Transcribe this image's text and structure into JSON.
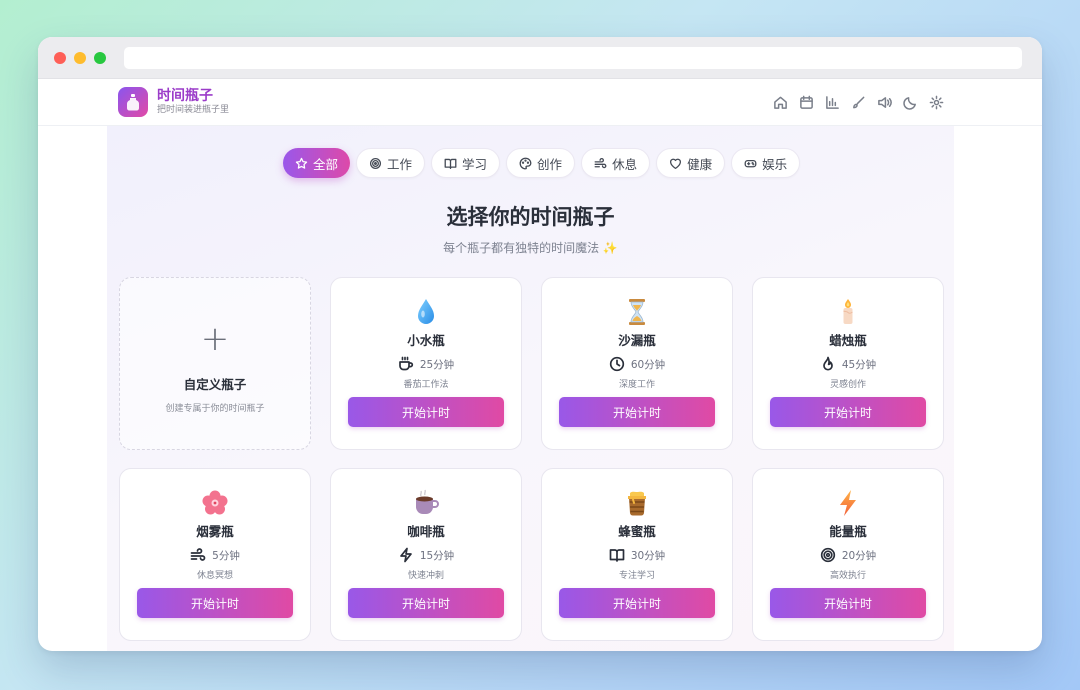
{
  "app": {
    "title": "时间瓶子",
    "subtitle": "把时间装进瓶子里"
  },
  "header_icons": [
    "home-icon",
    "calendar-icon",
    "chart-icon",
    "brush-icon",
    "volume-icon",
    "moon-icon",
    "gear-icon"
  ],
  "tabs": [
    {
      "label": "全部",
      "icon": "star-icon",
      "active": true
    },
    {
      "label": "工作",
      "icon": "target-icon",
      "active": false
    },
    {
      "label": "学习",
      "icon": "book-icon",
      "active": false
    },
    {
      "label": "创作",
      "icon": "palette-icon",
      "active": false
    },
    {
      "label": "休息",
      "icon": "wind-icon",
      "active": false
    },
    {
      "label": "健康",
      "icon": "heart-icon",
      "active": false
    },
    {
      "label": "娱乐",
      "icon": "gamepad-icon",
      "active": false
    }
  ],
  "main": {
    "title": "选择你的时间瓶子",
    "subtitle": "每个瓶子都有独特的时间魔法 ✨"
  },
  "custom_card": {
    "plus": "+",
    "title": "自定义瓶子",
    "subtitle": "创建专属于你的时间瓶子"
  },
  "bottles": [
    {
      "name": "小水瓶",
      "duration": "25分钟",
      "desc": "番茄工作法",
      "emoji": "droplet-emoji",
      "dur_icon": "coffee-icon",
      "button": "开始计时"
    },
    {
      "name": "沙漏瓶",
      "duration": "60分钟",
      "desc": "深度工作",
      "emoji": "hourglass-emoji",
      "dur_icon": "clock-icon",
      "button": "开始计时"
    },
    {
      "name": "蜡烛瓶",
      "duration": "45分钟",
      "desc": "灵感创作",
      "emoji": "candle-emoji",
      "dur_icon": "flame-icon",
      "button": "开始计时"
    },
    {
      "name": "烟雾瓶",
      "duration": "5分钟",
      "desc": "休息冥想",
      "emoji": "blossom-emoji",
      "dur_icon": "wind-icon",
      "button": "开始计时"
    },
    {
      "name": "咖啡瓶",
      "duration": "15分钟",
      "desc": "快速冲刺",
      "emoji": "coffee-cup-emoji",
      "dur_icon": "bolt-icon",
      "button": "开始计时"
    },
    {
      "name": "蜂蜜瓶",
      "duration": "30分钟",
      "desc": "专注学习",
      "emoji": "honey-pot-emoji",
      "dur_icon": "book-icon",
      "button": "开始计时"
    },
    {
      "name": "能量瓶",
      "duration": "20分钟",
      "desc": "高效执行",
      "emoji": "lightning-emoji",
      "dur_icon": "target-icon",
      "button": "开始计时"
    }
  ],
  "colors": {
    "accent_start": "#9958e8",
    "accent_end": "#e04aa4",
    "brand_title": "#9b3cc9"
  }
}
